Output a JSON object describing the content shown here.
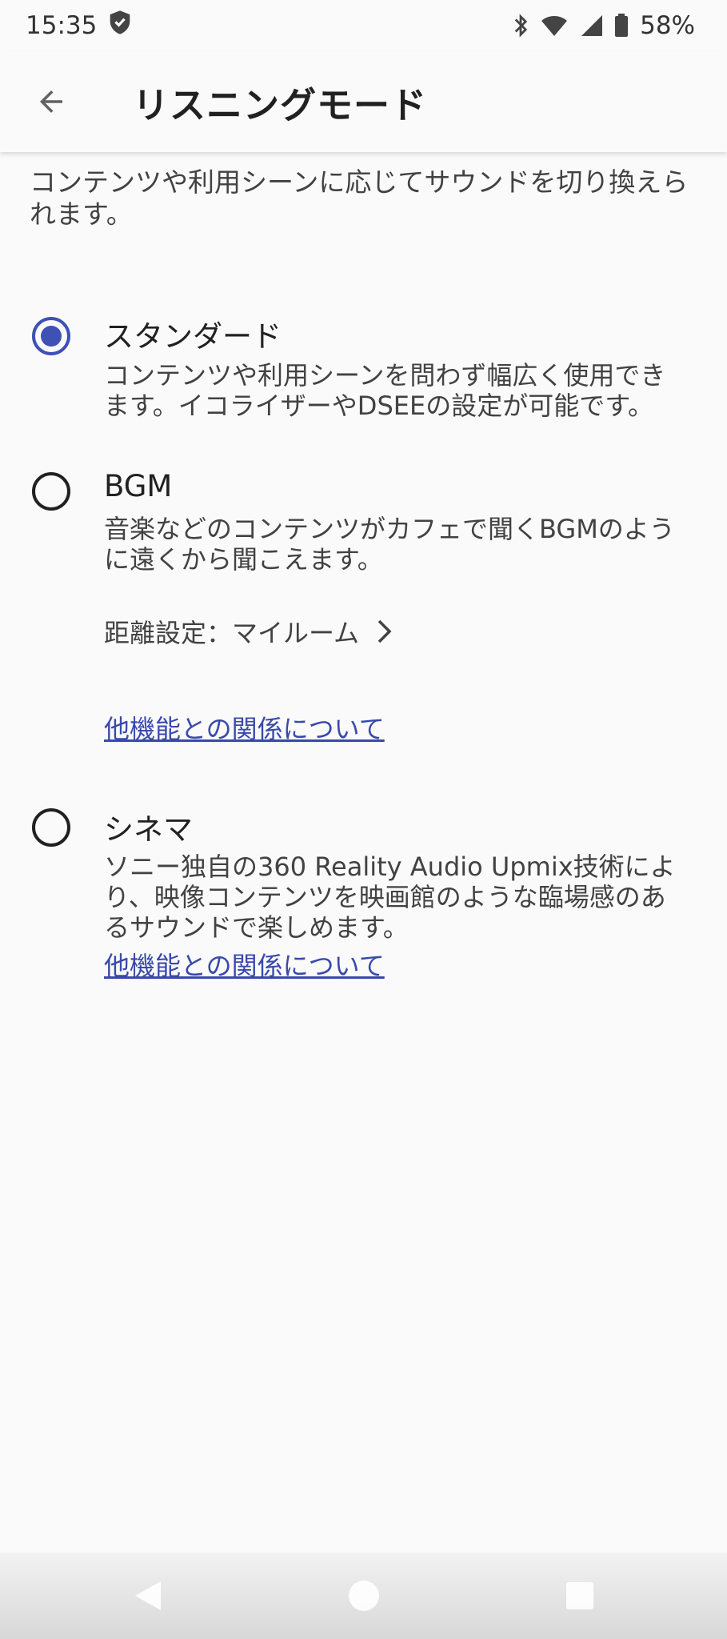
{
  "status_bar": {
    "time": "15:35",
    "battery_percent": "58%",
    "icons": [
      "shield-icon",
      "bluetooth-icon",
      "wifi-icon",
      "cellular-icon",
      "battery-icon"
    ]
  },
  "app_bar": {
    "title": "リスニングモード",
    "back_icon": "arrow-back-icon"
  },
  "intro": {
    "line1": "コンテンツや利用シーンに応じてサウンドを切り換えら",
    "line2": "れます。"
  },
  "options": [
    {
      "id": "standard",
      "title": "スタンダード",
      "selected": true,
      "desc_line1": "コンテンツや利用シーンを問わず幅広く使用でき",
      "desc_line2": "ます。イコライザーやDSEEの設定が可能です。"
    },
    {
      "id": "bgm",
      "title": "BGM",
      "selected": false,
      "desc_line1": "音楽などのコンテンツがカフェで聞くBGMのよう",
      "desc_line2": "に遠くから聞こえます。",
      "distance_label": "距離設定：マイルーム",
      "link": "他機能との関係について"
    },
    {
      "id": "cinema",
      "title": "シネマ",
      "selected": false,
      "desc_line1": "ソニー独自の360 Reality Audio Upmix技術によ",
      "desc_line2": "り、映像コンテンツを映画館のような臨場感のあ",
      "desc_line3": "るサウンドで楽しめます。",
      "link": "他機能との関係について"
    }
  ],
  "colors": {
    "accent": "#3f51b5",
    "link": "#3949ab",
    "background": "#fafafa"
  }
}
